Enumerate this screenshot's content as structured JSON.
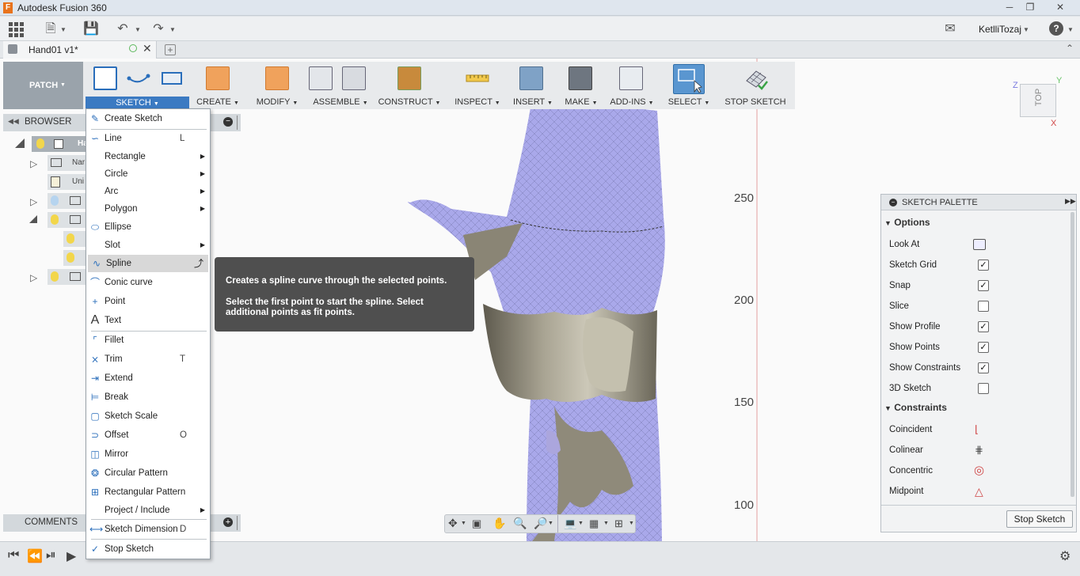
{
  "window": {
    "title": "Autodesk Fusion 360",
    "logo_letter": "F"
  },
  "appbar": {
    "user": "KetlliTozaj"
  },
  "document": {
    "tab_title": "Hand01 v1*"
  },
  "workspace": {
    "label": "PATCH"
  },
  "toolbar": {
    "groups": [
      {
        "label": "SKETCH"
      },
      {
        "label": "CREATE"
      },
      {
        "label": "MODIFY"
      },
      {
        "label": "ASSEMBLE"
      },
      {
        "label": "CONSTRUCT"
      },
      {
        "label": "INSPECT"
      },
      {
        "label": "INSERT"
      },
      {
        "label": "MAKE"
      },
      {
        "label": "ADD-INS"
      },
      {
        "label": "SELECT"
      },
      {
        "label": "STOP SKETCH"
      }
    ]
  },
  "browser": {
    "label": "BROWSER",
    "rows": [
      "Ha",
      "Nar",
      "Uni"
    ]
  },
  "comments": {
    "label": "COMMENTS"
  },
  "menu": {
    "items": [
      {
        "label": "Create Sketch",
        "key": "",
        "sub": false
      },
      {
        "label": "Line",
        "key": "L",
        "sub": false
      },
      {
        "label": "Rectangle",
        "key": "",
        "sub": true
      },
      {
        "label": "Circle",
        "key": "",
        "sub": true
      },
      {
        "label": "Arc",
        "key": "",
        "sub": true
      },
      {
        "label": "Polygon",
        "key": "",
        "sub": true
      },
      {
        "label": "Ellipse",
        "key": "",
        "sub": false
      },
      {
        "label": "Slot",
        "key": "",
        "sub": true
      },
      {
        "label": "Spline",
        "key": "",
        "sub": false,
        "highlight": true
      },
      {
        "label": "Conic curve",
        "key": "",
        "sub": false
      },
      {
        "label": "Point",
        "key": "",
        "sub": false
      },
      {
        "label": "Text",
        "key": "",
        "sub": false
      },
      {
        "label": "Fillet",
        "key": "",
        "sub": false
      },
      {
        "label": "Trim",
        "key": "T",
        "sub": false
      },
      {
        "label": "Extend",
        "key": "",
        "sub": false
      },
      {
        "label": "Break",
        "key": "",
        "sub": false
      },
      {
        "label": "Sketch Scale",
        "key": "",
        "sub": false
      },
      {
        "label": "Offset",
        "key": "O",
        "sub": false
      },
      {
        "label": "Mirror",
        "key": "",
        "sub": false
      },
      {
        "label": "Circular Pattern",
        "key": "",
        "sub": false
      },
      {
        "label": "Rectangular Pattern",
        "key": "",
        "sub": false
      },
      {
        "label": "Project / Include",
        "key": "",
        "sub": true
      },
      {
        "label": "Sketch Dimension",
        "key": "D",
        "sub": false
      },
      {
        "label": "Stop Sketch",
        "key": "",
        "sub": false
      }
    ]
  },
  "tooltip": {
    "title": "Creates a spline curve through the selected points.",
    "body": "Select the first point to start the spline. Select additional points as fit points."
  },
  "ruler": {
    "labels": [
      "250",
      "200",
      "150",
      "100"
    ]
  },
  "viewcube": {
    "face": "TOP",
    "axis_z": "Z",
    "axis_y": "Y",
    "axis_x": "X"
  },
  "palette": {
    "title": "SKETCH PALETTE",
    "options_header": "Options",
    "options": [
      {
        "label": "Look At",
        "type": "button"
      },
      {
        "label": "Sketch Grid",
        "type": "check",
        "checked": true
      },
      {
        "label": "Snap",
        "type": "check",
        "checked": true
      },
      {
        "label": "Slice",
        "type": "check",
        "checked": false
      },
      {
        "label": "Show Profile",
        "type": "check",
        "checked": true
      },
      {
        "label": "Show Points",
        "type": "check",
        "checked": true
      },
      {
        "label": "Show Constraints",
        "type": "check",
        "checked": true
      },
      {
        "label": "3D Sketch",
        "type": "check",
        "checked": false
      }
    ],
    "constraints_header": "Constraints",
    "constraints": [
      "Coincident",
      "Colinear",
      "Concentric",
      "Midpoint"
    ],
    "stop_label": "Stop Sketch"
  },
  "colors": {
    "accent": "#2a6ebb",
    "mesh": "#a8a7e8",
    "surface": "#8a8575",
    "tooltip": "#4f4f4f"
  }
}
